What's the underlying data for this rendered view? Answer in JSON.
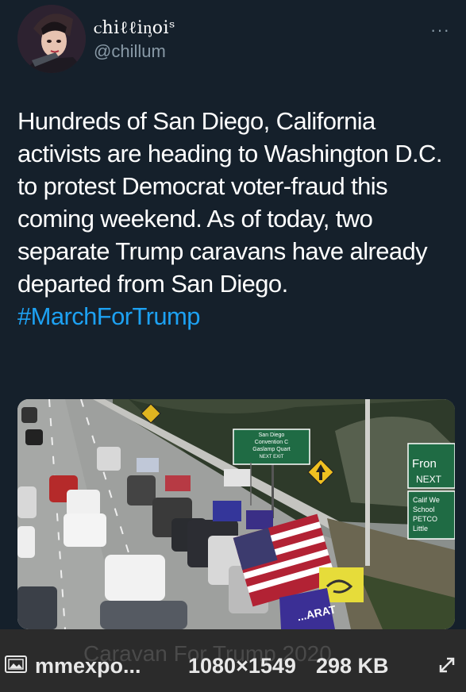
{
  "tweet": {
    "display_name": "ꮯhiℓℓiᶇoiˢ",
    "handle": "@chillum",
    "more_label": "···",
    "text": "Hundreds of San Diego, California activists are heading to Washington D.C. to protest Democrat voter-fraud this coming weekend. As of today, two separate Trump caravans have already departed from San Diego.",
    "hashtag": "#MarchForTrump"
  },
  "photo": {
    "signs": {
      "san_diego": [
        "San Diego",
        "Convention C",
        "Gaslamp Quart",
        "NEXT EXIT"
      ],
      "front": [
        "Fron",
        "NEXT"
      ],
      "calif": [
        "Calif We",
        "School",
        "PETCO",
        "Little"
      ]
    },
    "banner_text": "...ARAT"
  },
  "viewer_bar": {
    "ghost_caption": "Caravan For Trump 2020",
    "file_name": "mmexpo...",
    "dimensions": "1080×1549",
    "file_size": "298 KB",
    "image_icon": "image-icon",
    "expand_icon": "expand-icon"
  },
  "colors": {
    "background": "#15202b",
    "link": "#1da1f2",
    "muted": "#8899a6",
    "bar": "#2b2b2b"
  }
}
